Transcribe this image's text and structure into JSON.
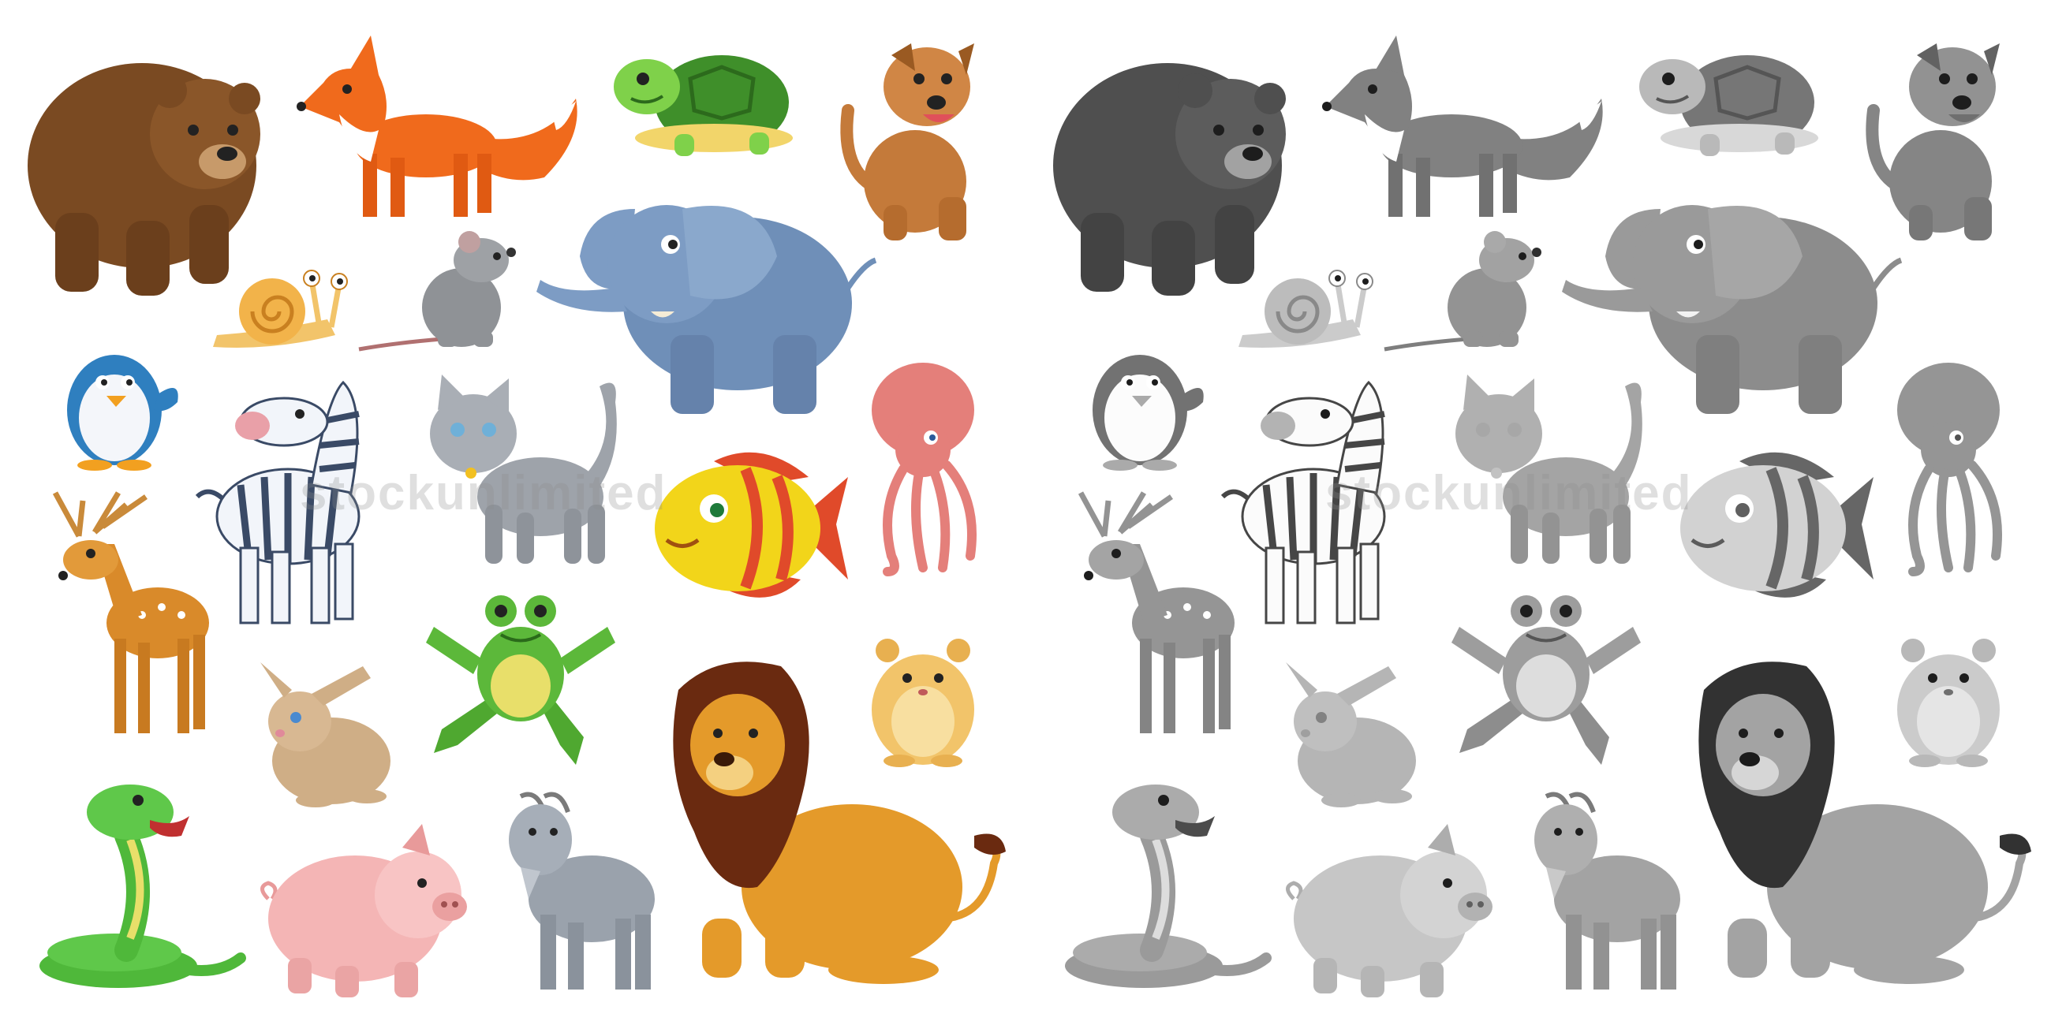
{
  "watermark": {
    "text": "stockunlimited"
  },
  "panels": [
    {
      "variant": "color",
      "rendering": "full color"
    },
    {
      "variant": "grayscale",
      "rendering": "black and white"
    }
  ],
  "animals": [
    {
      "id": "bear",
      "name": "bear",
      "color": "#7a4a22"
    },
    {
      "id": "fox",
      "name": "fox",
      "color": "#f06a1c"
    },
    {
      "id": "turtle",
      "name": "turtle",
      "color": "#6dbf2a"
    },
    {
      "id": "dog",
      "name": "dog",
      "color": "#c47a3a"
    },
    {
      "id": "snail",
      "name": "snail",
      "color": "#f2b34a"
    },
    {
      "id": "rat",
      "name": "rat",
      "color": "#8f9296"
    },
    {
      "id": "elephant",
      "name": "elephant",
      "color": "#6f8fb8"
    },
    {
      "id": "penguin",
      "name": "penguin",
      "color": "#2f7fbf"
    },
    {
      "id": "zebra",
      "name": "zebra",
      "color": "#3a4a66"
    },
    {
      "id": "cat",
      "name": "cat",
      "color": "#9ea3aa"
    },
    {
      "id": "octopus",
      "name": "octopus",
      "color": "#e47f7a"
    },
    {
      "id": "deer",
      "name": "deer",
      "color": "#d98a2a"
    },
    {
      "id": "fish",
      "name": "fish",
      "color": "#f2d51a"
    },
    {
      "id": "frog",
      "name": "frog",
      "color": "#5cb83a"
    },
    {
      "id": "rabbit",
      "name": "rabbit",
      "color": "#cfae86"
    },
    {
      "id": "hamster",
      "name": "hamster",
      "color": "#f2c46a"
    },
    {
      "id": "lion",
      "name": "lion",
      "color": "#e49a2a"
    },
    {
      "id": "snake",
      "name": "snake",
      "color": "#4fb83a"
    },
    {
      "id": "pig",
      "name": "pig",
      "color": "#f4b5b5"
    },
    {
      "id": "goat",
      "name": "goat",
      "color": "#9aa2ac"
    }
  ]
}
